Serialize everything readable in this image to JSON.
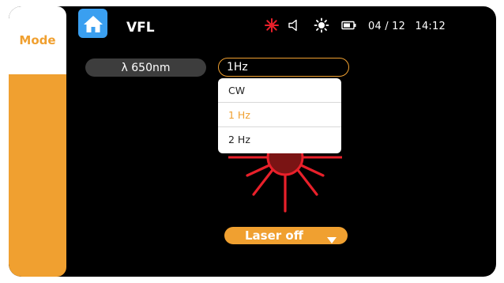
{
  "sidebar": {
    "mode_label": "Mode"
  },
  "header": {
    "title": "VFL",
    "home_icon": "home-icon",
    "status": {
      "laser_icon": "laser-active-icon",
      "sound_icon": "speaker-icon",
      "brightness_icon": "brightness-icon",
      "battery_icon": "battery-icon",
      "date": "04 / 12",
      "time": "14:12"
    }
  },
  "main": {
    "wavelength_label": "λ 650nm",
    "frequency": {
      "selected": "1Hz",
      "options": [
        "CW",
        "1 Hz",
        "2 Hz"
      ],
      "selected_index": 1
    },
    "laser_button": {
      "label": "Laser off",
      "caret_icon": "caret-down-icon"
    }
  },
  "colors": {
    "accent": "#f0a030",
    "home_blue": "#3a9ff0",
    "laser_red": "#e8202a",
    "background": "#000000"
  }
}
